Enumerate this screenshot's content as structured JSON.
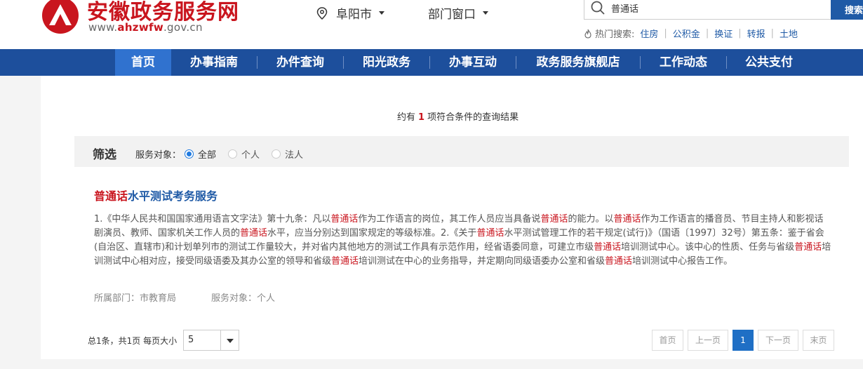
{
  "header": {
    "site_name": "安徽政务服务网",
    "url_prefix": "www.",
    "url_mid": "ahzwfw",
    "url_suffix": ".gov.cn",
    "city": "阜阳市",
    "dept": "部门窗口",
    "search_value": "普通话",
    "search_button": "搜索",
    "hot_label": "热门搜索:",
    "hot_keywords": [
      "住房",
      "公积金",
      "换证",
      "转报",
      "土地"
    ]
  },
  "nav": [
    "首页",
    "办事指南",
    "办件查询",
    "阳光政务",
    "办事互动",
    "政务服务旗舰店",
    "工作动态",
    "公共支付"
  ],
  "result": {
    "prefix": "约有",
    "count": "1",
    "suffix": "项符合条件的查询结果"
  },
  "filter": {
    "title": "筛选",
    "label": "服务对象：",
    "options": [
      "全部",
      "个人",
      "法人"
    ],
    "selected": "全部"
  },
  "item": {
    "title_hl": "普通话",
    "title_rest": "水平测试考务服务",
    "body_segments": [
      {
        "t": "1.《中华人民共和国国家通用语言文字法》第十九条：凡以"
      },
      {
        "t": "普通话",
        "hl": true
      },
      {
        "t": "作为工作语言的岗位，其工作人员应当具备说"
      },
      {
        "t": "普通话",
        "hl": true
      },
      {
        "t": "的能力。以"
      },
      {
        "t": "普通话",
        "hl": true
      },
      {
        "t": "作为工作语言的播音员、节目主持人和影视话剧演员、教师、国家机关工作人员的"
      },
      {
        "t": "普通话",
        "hl": true
      },
      {
        "t": "水平，应当分别达到国家规定的等级标准。2.《关于"
      },
      {
        "t": "普通话",
        "hl": true
      },
      {
        "t": "水平测试管理工作的若干规定(试行)》（国语〔1997〕32号）第五条：鉴于省会(自治区、直辖市)和计划单列市的测试工作量较大，并对省内其他地方的测试工作具有示范作用，经省语委同意，可建立市级"
      },
      {
        "t": "普通话",
        "hl": true
      },
      {
        "t": "培训测试中心。该中心的性质、任务与省级"
      },
      {
        "t": "普通话",
        "hl": true
      },
      {
        "t": "培训测试中心相对应，接受同级语委及其办公室的领导和省级"
      },
      {
        "t": "普通话",
        "hl": true
      },
      {
        "t": "培训测试在中心的业务指导，并定期向同级语委办公室和省级"
      },
      {
        "t": "普通话",
        "hl": true
      },
      {
        "t": "培训测试中心报告工作。"
      }
    ],
    "dept_label": "所属部门：",
    "dept_value": "市教育局",
    "target_label": "服务对象：",
    "target_value": "个人"
  },
  "pager": {
    "summary": "总1条，共1页",
    "size_label": "每页大小",
    "size_value": "5",
    "first": "首页",
    "prev": "上一页",
    "current": "1",
    "next": "下一页",
    "last": "末页"
  },
  "colors": {
    "brand_red": "#c9151e",
    "nav_blue": "#1d4f9c",
    "nav_active": "#3072cf",
    "link_blue": "#1f5aa6"
  }
}
